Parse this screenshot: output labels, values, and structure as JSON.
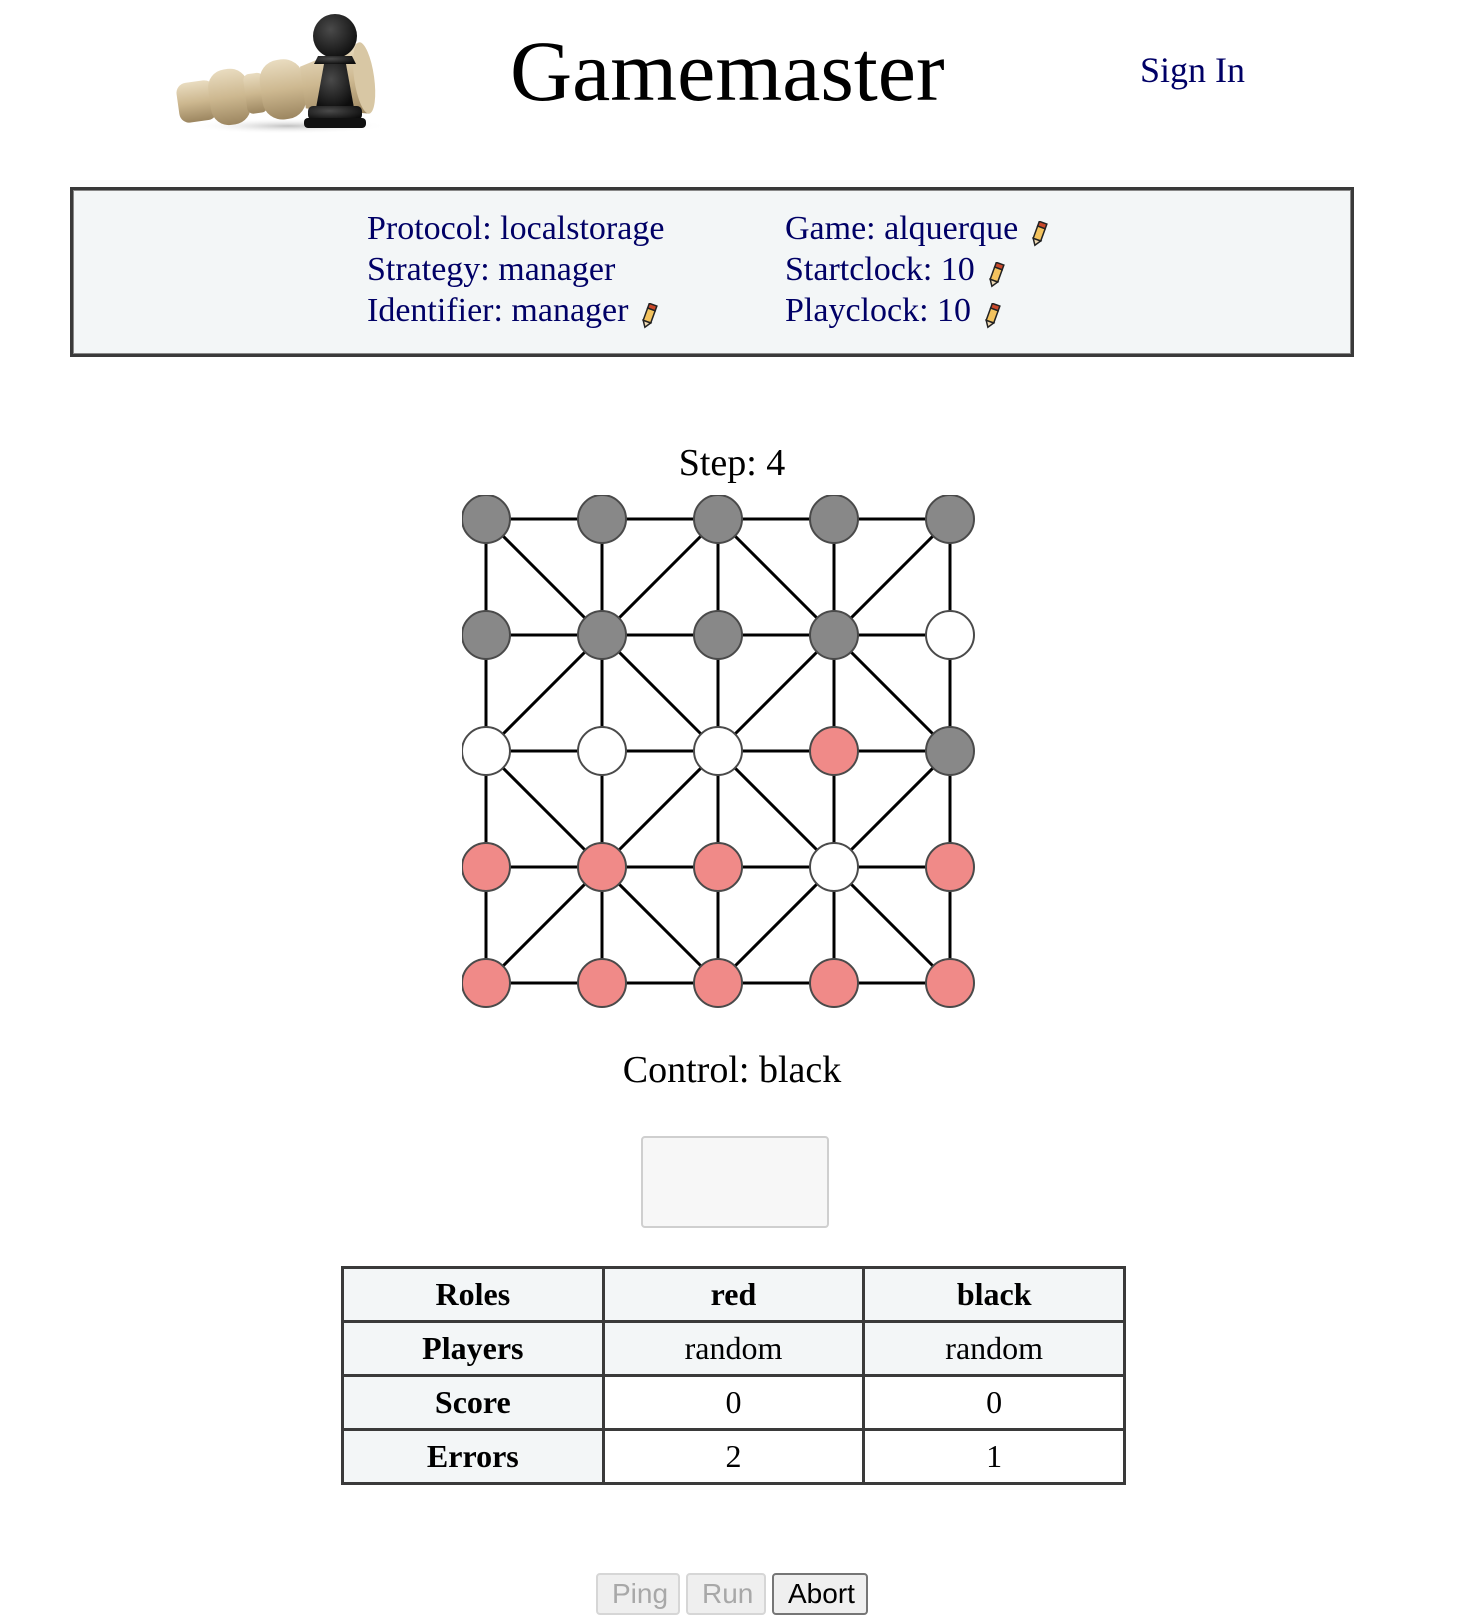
{
  "header": {
    "title": "Gamemaster",
    "sign_in": "Sign In",
    "logo_icon": "chess-pieces-logo"
  },
  "info": {
    "left": [
      {
        "label": "Protocol",
        "value": "localstorage",
        "editable": false
      },
      {
        "label": "Strategy",
        "value": "manager",
        "editable": false
      },
      {
        "label": "Identifier",
        "value": "manager",
        "editable": true
      }
    ],
    "right": [
      {
        "label": "Game",
        "value": "alquerque",
        "editable": true
      },
      {
        "label": "Startclock",
        "value": "10",
        "editable": true
      },
      {
        "label": "Playclock",
        "value": "10",
        "editable": true
      }
    ],
    "protocol_text": "Protocol: localstorage",
    "strategy_text": "Strategy: manager",
    "identifier_text": "Identifier: manager",
    "game_text": "Game: alquerque",
    "startclock_text": "Startclock: 10",
    "playclock_text": "Playclock: 10",
    "edit_icon": "pencil-icon"
  },
  "game": {
    "step_text": "Step: 4",
    "step": 4,
    "control_text": "Control: black",
    "control": "black",
    "board": [
      [
        "black",
        "black",
        "black",
        "black",
        "black"
      ],
      [
        "black",
        "black",
        "black",
        "black",
        "empty"
      ],
      [
        "empty",
        "empty",
        "empty",
        "red",
        "black"
      ],
      [
        "red",
        "red",
        "red",
        "empty",
        "red"
      ],
      [
        "red",
        "red",
        "red",
        "red",
        "red"
      ]
    ],
    "colors": {
      "black": "#888888",
      "red": "#f08a88",
      "empty": "#ffffff",
      "line": "#000000"
    }
  },
  "move_input": {
    "value": ""
  },
  "table": {
    "headers": [
      "Roles",
      "red",
      "black"
    ],
    "rows": [
      {
        "label": "Players",
        "values": [
          "random",
          "random"
        ]
      },
      {
        "label": "Score",
        "values": [
          "0",
          "0"
        ]
      },
      {
        "label": "Errors",
        "values": [
          "2",
          "1"
        ]
      }
    ]
  },
  "buttons": {
    "ping": "Ping",
    "run": "Run",
    "abort": "Abort"
  }
}
